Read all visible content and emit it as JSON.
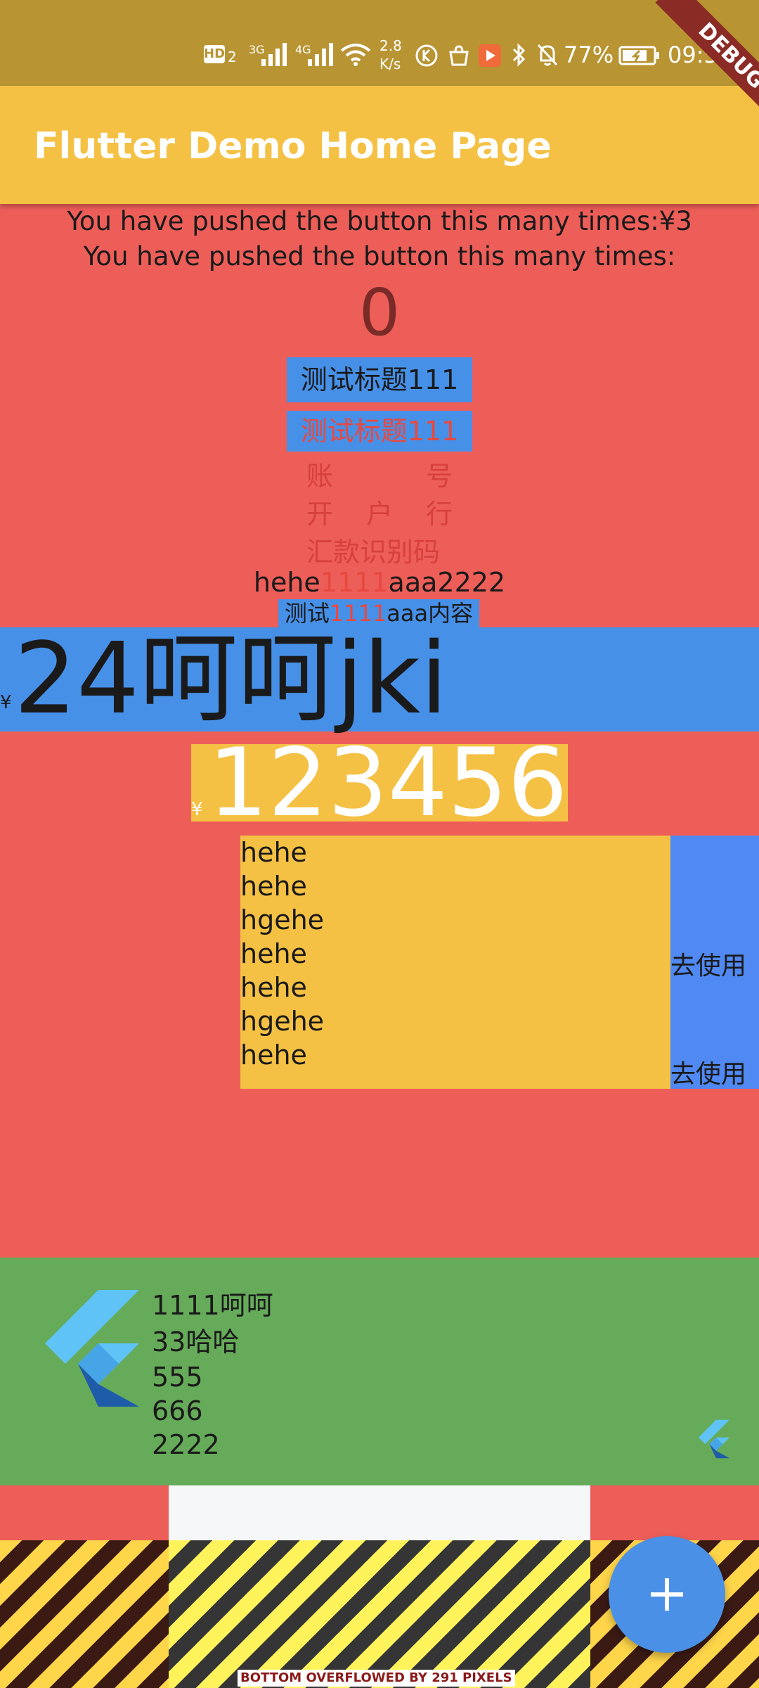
{
  "status_bar": {
    "hd_label": "HD",
    "hd_sub": "2",
    "net_3g": "3G",
    "net_4g": "4G",
    "speed_value": "2.8",
    "speed_unit": "K/s",
    "battery": "77%",
    "time": "09:58"
  },
  "debug_banner": "DEBUG",
  "app_bar": {
    "title": "Flutter Demo Home Page"
  },
  "content": {
    "line1": "You have pushed the button this many times:¥3",
    "line2": "You have pushed the button this many times:",
    "counter": "0",
    "title_box1": "测试标题111",
    "title_box2": "测试标题111",
    "label_rows": [
      [
        "账",
        "号"
      ],
      [
        "开",
        "户",
        "行"
      ],
      [
        "汇款识别码"
      ]
    ],
    "mixed_line": {
      "a": "hehe",
      "b": "1111",
      "c": "aaa2222"
    },
    "small_box": {
      "a": "测试",
      "b": "1111",
      "c": "aaa内容"
    },
    "big_blue": {
      "currency": "¥",
      "text": "24呵呵jki"
    },
    "big_yellow": {
      "currency": "¥",
      "text": "123456"
    },
    "list_items": [
      "hehe",
      "hehe",
      "hgehe",
      "hehe",
      "hehe",
      "hgehe",
      "hehe"
    ],
    "use_labels": [
      "去使用",
      "去使用"
    ]
  },
  "card": {
    "lines": [
      "1111呵呵",
      "33哈哈",
      "555",
      "666",
      "2222"
    ]
  },
  "overflow_label": "BOTTOM OVERFLOWED BY 291 PIXELS",
  "colors": {
    "background": "#ed5e59",
    "app_bar": "#f5c144",
    "status_bar": "#b89433",
    "blue": "#4790e8",
    "yellow": "#f5c144",
    "green": "#66ab5a",
    "fab": "#4a90e6"
  },
  "icons": {
    "fab": "plus-icon",
    "card_logo": "flutter-logo-icon"
  }
}
